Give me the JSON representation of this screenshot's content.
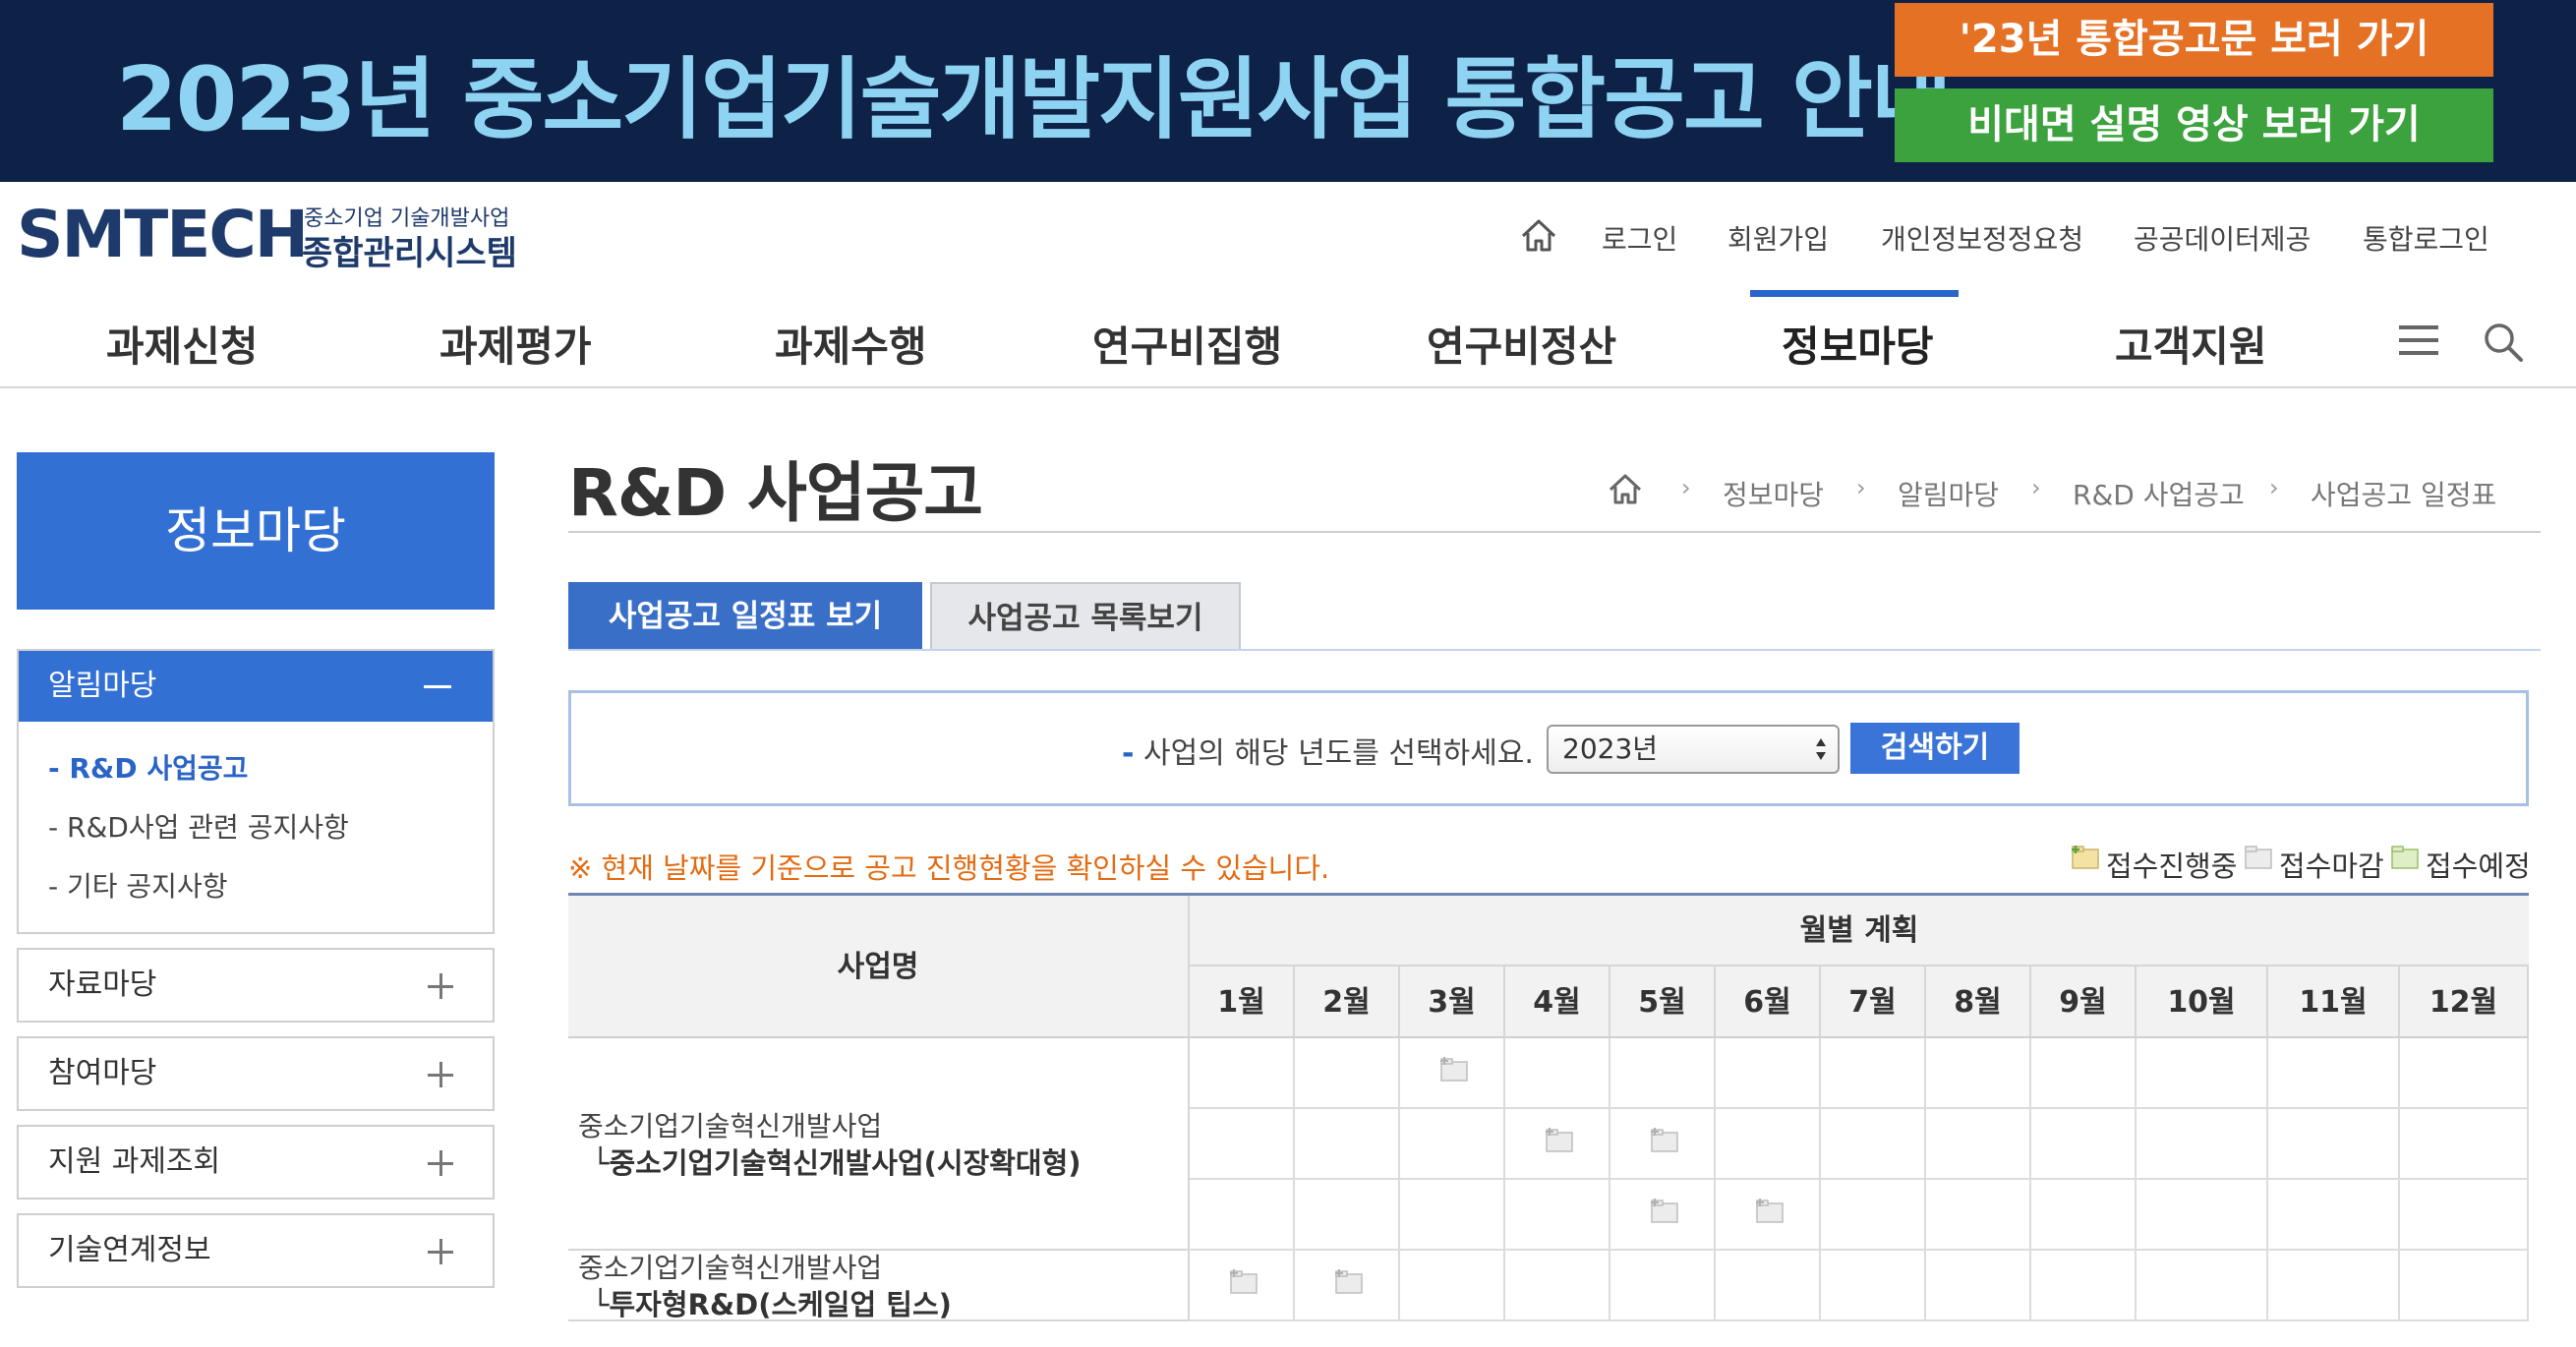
{
  "banner": {
    "title": "2023년 중소기업기술개발지원사업 통합공고 안내",
    "btn_notice": "'23년 통합공고문 보러 가기",
    "btn_video": "비대면 설명 영상 보러 가기",
    "colors": {
      "background": "#0e2247",
      "title": "#8fd3f2",
      "orange": "#e57125",
      "green": "#3ba23e"
    }
  },
  "logo": {
    "main": "SMTECH",
    "sub1": "중소기업 기술개발사업",
    "sub2": "종합관리시스템"
  },
  "util_nav": {
    "home_icon": "home-icon",
    "links": [
      "로그인",
      "회원가입",
      "개인정보정정요청",
      "공공데이터제공",
      "통합로그인"
    ]
  },
  "gnb": {
    "items": [
      "과제신청",
      "과제평가",
      "과제수행",
      "연구비집행",
      "연구비정산",
      "정보마당",
      "고객지원"
    ],
    "active": "정보마당",
    "menu_icon": "hamburger-menu-icon",
    "search_icon": "search-icon",
    "accent": "#2a64c8"
  },
  "sidebar": {
    "title": "정보마당",
    "open_section": {
      "label": "알림마당",
      "items": [
        "- R&D 사업공고",
        "- R&D사업 관련 공지사항",
        "- 기타 공지사항"
      ],
      "active_index": 0
    },
    "sections": [
      "자료마당",
      "참여마당",
      "지원 과제조회",
      "기술연계정보"
    ]
  },
  "page": {
    "title": "R&D 사업공고",
    "breadcrumb": [
      "정보마당",
      "알림마당",
      "R&D 사업공고",
      "사업공고 일정표"
    ],
    "breadcrumb_sep": "›",
    "tabs": [
      "사업공고 일정표 보기",
      "사업공고 목록보기"
    ],
    "active_tab": 0
  },
  "search": {
    "dash": "-",
    "label": "사업의 해당 년도를 선택하세요.",
    "year": "2023년",
    "button": "검색하기"
  },
  "notice": "※ 현재 날짜를 기준으로 공고 진행현황을 확인하실 수 있습니다.",
  "legend": [
    {
      "label": "접수진행중",
      "icon": "folder-open-icon"
    },
    {
      "label": "접수마감",
      "icon": "folder-closed-icon"
    },
    {
      "label": "접수예정",
      "icon": "folder-scheduled-icon"
    }
  ],
  "table": {
    "col_name": "사업명",
    "col_plan": "월별 계획",
    "months": [
      "1월",
      "2월",
      "3월",
      "4월",
      "5월",
      "6월",
      "7월",
      "8월",
      "9월",
      "10월",
      "11월",
      "12월"
    ],
    "groups": [
      {
        "main": "중소기업기술혁신개발사업",
        "sub": "└중소기업기술혁신개발사업(시장확대형)",
        "rows": [
          [
            3
          ],
          [
            4,
            5
          ],
          [
            5,
            6
          ]
        ]
      },
      {
        "main": "중소기업기술혁신개발사업",
        "sub": "└투자형R&D(스케일업 팁스)",
        "rows": [
          [
            1,
            2
          ]
        ]
      }
    ],
    "cell_status": "접수마감"
  }
}
